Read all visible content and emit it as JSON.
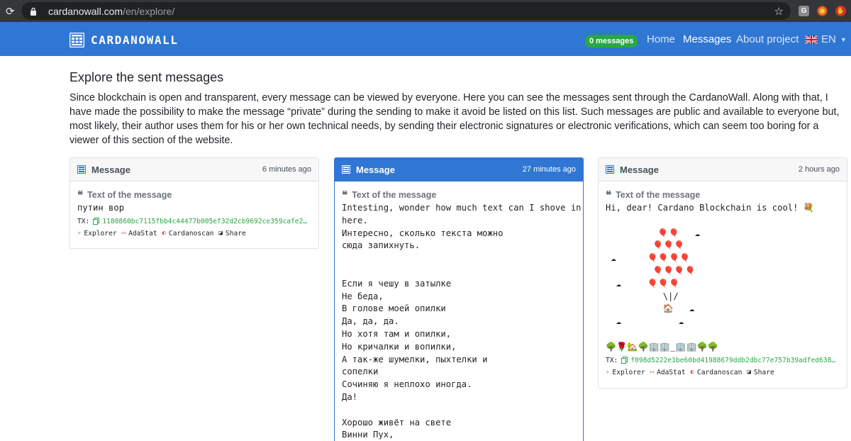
{
  "browser": {
    "url_host": "cardanowall.com",
    "url_path": "/en/explore/",
    "ext_g_label": "G"
  },
  "navbar": {
    "brand": "CARDANOWALL",
    "badge": "0 messages",
    "links": [
      {
        "label": "Home"
      },
      {
        "label": "Messages",
        "active": true
      },
      {
        "label": "About project"
      }
    ],
    "lang": "EN",
    "colors": {
      "background": "#2f77d3",
      "badge": "#28a745"
    }
  },
  "page": {
    "title": "Explore the sent messages",
    "intro": "Since blockchain is open and transparent, every message can be viewed by everyone. Here you can see the messages sent through the CardanoWall. Along with that, I have made the possibility to make the message “private” during the sending to make it avoid be listed on this list. Such messages are public and available to everyone but, most likely, their author uses them for his or her own technical needs, by sending their electronic signatures or electronic verifications, which can seem too boring for a viewer of this section of the website."
  },
  "cards": [
    {
      "title": "Message",
      "time": "6 minutes ago",
      "label": "Text of the message",
      "text": "путин вор",
      "tx_label": "TX:",
      "tx": "1180860bc7115fbb4c44477b005ef32d2cb9692ce359cafe2be61...",
      "links": [
        "Explorer",
        "AdaStat",
        "Cardanoscan",
        "Share"
      ]
    },
    {
      "title": "Message",
      "time": "27 minutes ago",
      "label": "Text of the message",
      "text": "Intesting, wonder how much text can I shove in\nhere.\nИнтересно, сколько текста можно\nсюда запихнуть.\n\n\nЕсли я чешу в затылке\nНе беда,\nВ голове моей опилки\nДа, да, да.\nНо хотя там и опилки,\nНо кричалки и вопилки,\nА так-же шумелки, пыхтелки и\nсопелки\nСочиняю я неплохо иногда.\nДа!\n\nХорошо живёт на свете\nВинни Пух,"
    },
    {
      "title": "Message",
      "time": "2 hours ago",
      "label": "Text of the message",
      "text": "Hi, dear! Cardano Blockchain is cool! 💐\n\n          🎈🎈   ☁\n         🎈🎈🎈\n ☁      🎈🎈🎈🎈\n         🎈🎈🎈🎈\n  ☁     🎈🎈🎈\n           \\|/\n           🏠   ☁\n  ☁           ☁\n\n🌳🌹🏡🌳🏢🏢_🏢🏢🌳🌳",
      "tx_label": "TX:",
      "tx": "f098d5222e1be60bd41988679ddb2dbc77e757b39adfed63811da...",
      "links": [
        "Explorer",
        "AdaStat",
        "Cardanoscan",
        "Share"
      ]
    }
  ]
}
